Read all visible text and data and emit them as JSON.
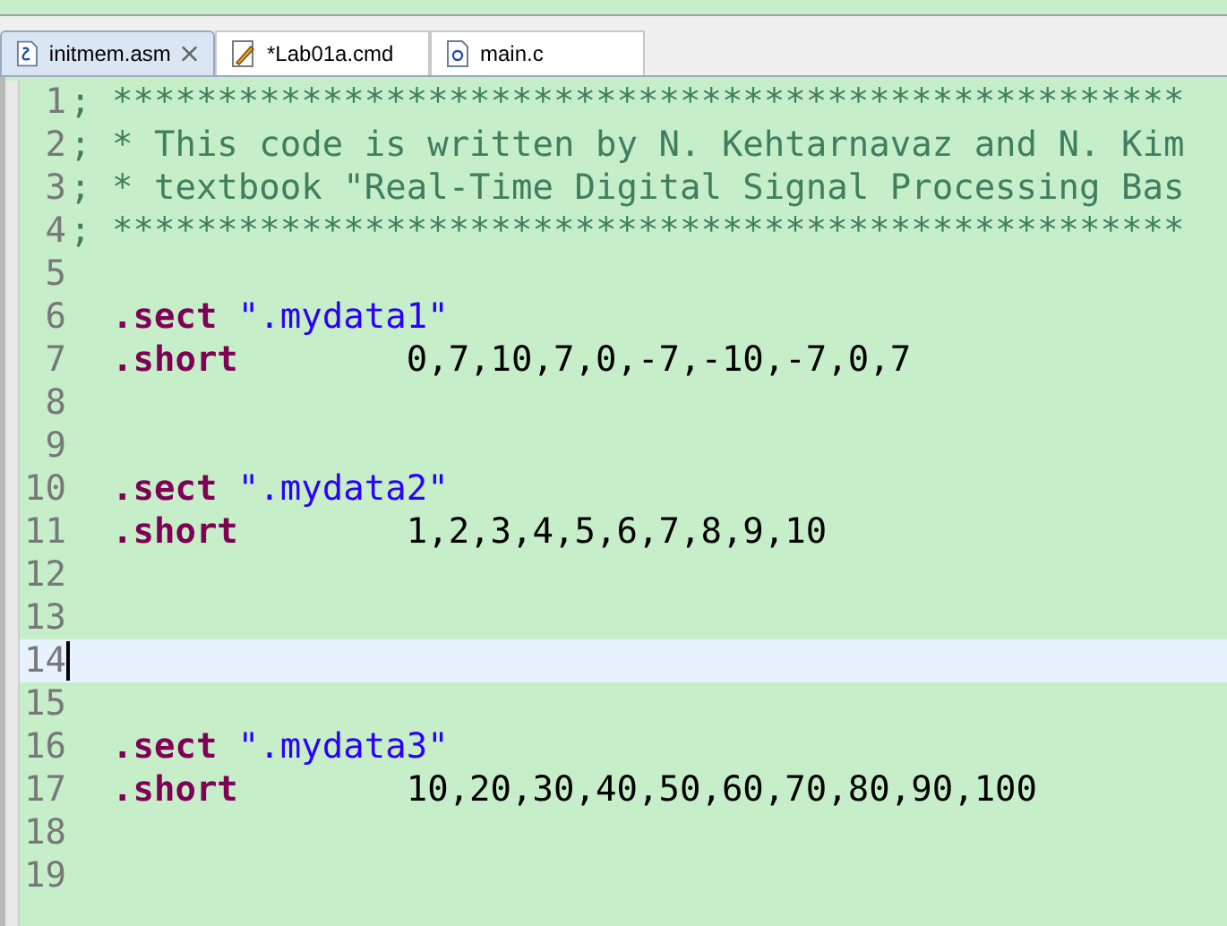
{
  "tabs": [
    {
      "label": "initmem.asm",
      "kind": "asm",
      "selected": true,
      "closable": true
    },
    {
      "label": "*Lab01a.cmd",
      "kind": "cmd",
      "selected": false,
      "closable": false
    },
    {
      "label": "main.c",
      "kind": "c",
      "selected": false,
      "closable": false
    }
  ],
  "editor": {
    "lines": [
      {
        "number": "1",
        "current": false,
        "segments": [
          {
            "kind": "comment",
            "text": "; ***************************************************"
          }
        ]
      },
      {
        "number": "2",
        "current": false,
        "segments": [
          {
            "kind": "comment",
            "text": "; * This code is written by N. Kehtarnavaz and N. Kim"
          }
        ]
      },
      {
        "number": "3",
        "current": false,
        "segments": [
          {
            "kind": "comment",
            "text": "; * textbook \"Real-Time Digital Signal Processing Bas"
          }
        ]
      },
      {
        "number": "4",
        "current": false,
        "segments": [
          {
            "kind": "comment",
            "text": "; ***************************************************"
          }
        ]
      },
      {
        "number": "5",
        "current": false
      },
      {
        "number": "6",
        "current": false,
        "segments": [
          {
            "kind": "directive",
            "text": "  .sect "
          },
          {
            "kind": "string",
            "text": "\".mydata1\""
          }
        ]
      },
      {
        "number": "7",
        "current": false,
        "segments": [
          {
            "kind": "directive",
            "text": "  .short"
          },
          {
            "kind": "plain",
            "text": "        0,7,10,7,0,-7,-10,-7,0,7"
          }
        ]
      },
      {
        "number": "8",
        "current": false
      },
      {
        "number": "9",
        "current": false
      },
      {
        "number": "10",
        "current": false,
        "segments": [
          {
            "kind": "directive",
            "text": "  .sect "
          },
          {
            "kind": "string",
            "text": "\".mydata2\""
          }
        ]
      },
      {
        "number": "11",
        "current": false,
        "segments": [
          {
            "kind": "directive",
            "text": "  .short"
          },
          {
            "kind": "plain",
            "text": "        1,2,3,4,5,6,7,8,9,10"
          }
        ]
      },
      {
        "number": "12",
        "current": false
      },
      {
        "number": "13",
        "current": false
      },
      {
        "number": "14",
        "current": true
      },
      {
        "number": "15",
        "current": false
      },
      {
        "number": "16",
        "current": false,
        "segments": [
          {
            "kind": "directive",
            "text": "  .sect "
          },
          {
            "kind": "string",
            "text": "\".mydata3\""
          }
        ]
      },
      {
        "number": "17",
        "current": false,
        "segments": [
          {
            "kind": "directive",
            "text": "  .short"
          },
          {
            "kind": "plain",
            "text": "        10,20,30,40,50,60,70,80,90,100"
          }
        ]
      },
      {
        "number": "18",
        "current": false
      },
      {
        "number": "19",
        "current": false
      }
    ]
  }
}
